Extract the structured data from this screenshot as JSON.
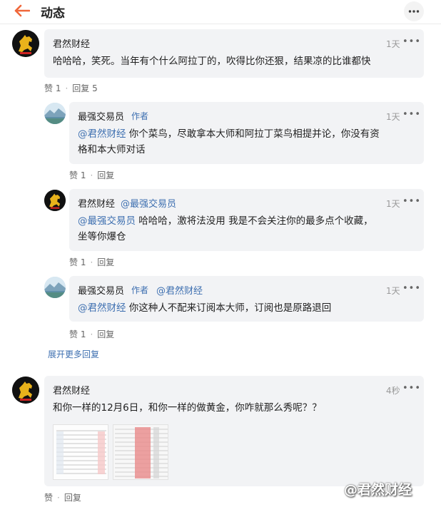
{
  "header": {
    "title": "动态"
  },
  "comments": [
    {
      "author": "君然财经",
      "time": "1天",
      "text": "哈哈哈，笑死。当年有个什么阿拉丁的，吹得比你还狠，结果凉的比谁都快",
      "likes": "赞 1",
      "reply": "回复 5"
    },
    {
      "author": "最强交易员",
      "tag": "作者",
      "time": "1天",
      "mention": "@君然财经",
      "text_line1": " 你个菜鸟，尽敢拿本大师和阿拉丁菜鸟相提并论，你没有资",
      "text_line2": "格和本大师对话",
      "likes": "赞 1",
      "reply": "回复"
    },
    {
      "author": "君然财经",
      "reply_to": "@最强交易员",
      "time": "1天",
      "mention": "@最强交易员",
      "text_line1": " 哈哈哈，激将法没用 我是不会关注你的最多点个收藏，",
      "text_line2": "坐等你爆仓",
      "likes": "赞 1",
      "reply": "回复"
    },
    {
      "author": "最强交易员",
      "tag": "作者",
      "reply_to": "@君然财经",
      "time": "1天",
      "mention": "@君然财经",
      "text_line1": " 你这种人不配来订阅本大师，订阅也是原路退回",
      "likes": "赞 1",
      "reply": "回复"
    },
    {
      "author": "君然财经",
      "time": "4秒",
      "text": "和你一样的12月6日，和你一样的做黄金，你咋就那么秀呢？？",
      "likes": "赞",
      "reply": "回复"
    }
  ],
  "expand_label": "展开更多回复",
  "watermark": "@君然财经",
  "colors": {
    "accent_orange": "#f0673a",
    "link_blue": "#3d6fb0",
    "bubble_bg": "#f2f3f5"
  },
  "icons": {
    "back": "arrow-left-icon",
    "more": "more-dots-icon"
  }
}
